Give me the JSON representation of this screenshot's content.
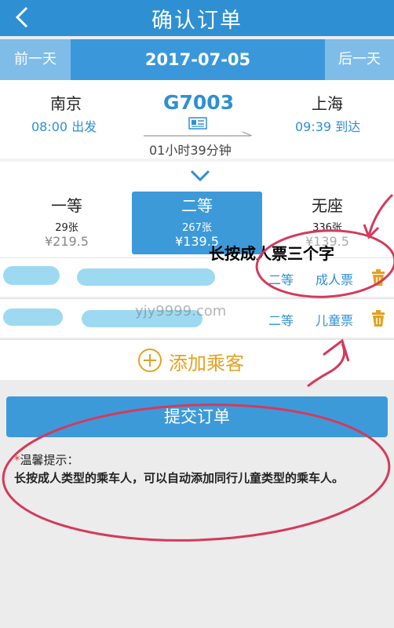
{
  "header": {
    "title": "确认订单",
    "back_icon": "chevron-left-icon"
  },
  "datebar": {
    "prev_label": "前一天",
    "date": "2017-07-05",
    "next_label": "后一天"
  },
  "train": {
    "from_city": "南京",
    "from_time": "08:00 出发",
    "number": "G7003",
    "duration": "01小时39分钟",
    "to_city": "上海",
    "to_time": "09:39 到达"
  },
  "seats": [
    {
      "class": "一等",
      "count": "29张",
      "price": "¥219.5",
      "selected": false
    },
    {
      "class": "二等",
      "count": "267张",
      "price": "¥139.5",
      "selected": true
    },
    {
      "class": "无座",
      "count": "336张",
      "price": "¥139.5",
      "selected": false
    }
  ],
  "passengers": [
    {
      "seat": "二等",
      "type": "成人票"
    },
    {
      "seat": "二等",
      "type": "儿童票"
    }
  ],
  "watermark": "yjy9999.com",
  "add_passenger": {
    "label": "添加乘客"
  },
  "submit": {
    "label": "提交订单"
  },
  "tips": {
    "title": "温馨提示：",
    "body": "长按成人类型的乘车人，可以自动添加同行儿童类型的乘车人。"
  },
  "annotation": {
    "text": "长按成人票三个字"
  },
  "colors": {
    "primary": "#2f8fd3",
    "accent": "#e3a221",
    "annotation": "#d43a5c"
  }
}
